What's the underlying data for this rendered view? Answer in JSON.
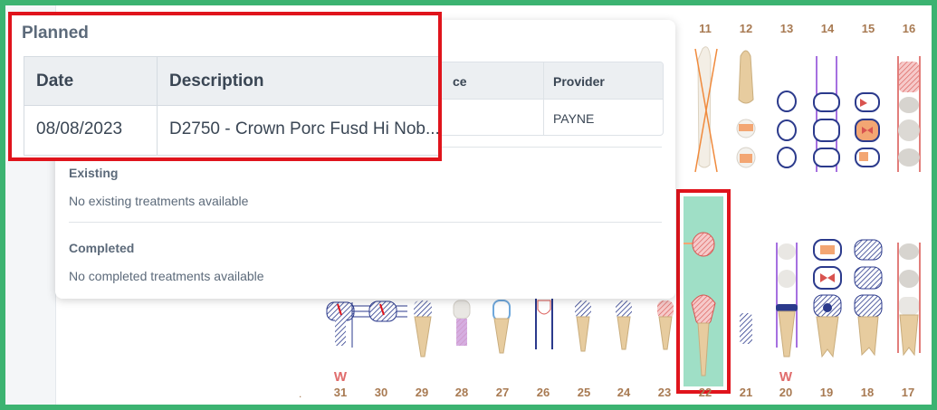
{
  "popover": {
    "planned": {
      "title": "Planned",
      "columns": [
        "Date",
        "Description"
      ],
      "rows": [
        {
          "date": "08/08/2023",
          "description": "D2750 - Crown Porc Fusd Hi Nob..."
        }
      ]
    },
    "background_table": {
      "columns": [
        "ce",
        "Provider"
      ],
      "rows": [
        {
          "provider": "PAYNE"
        }
      ]
    },
    "existing": {
      "title": "Existing",
      "empty_text": "No existing treatments available"
    },
    "completed": {
      "title": "Completed",
      "empty_text": "No completed treatments available"
    }
  },
  "chart": {
    "upper_teeth_numbers": [
      "11",
      "12",
      "13",
      "14",
      "15",
      "16"
    ],
    "lower_teeth_numbers": [
      "31",
      "30",
      "29",
      "28",
      "27",
      "26",
      "25",
      "24",
      "23",
      "22",
      "21",
      "20",
      "19",
      "18",
      "17"
    ],
    "markers": {
      "tooth_31": "W",
      "tooth_20": "W"
    },
    "dot": ".",
    "selected_tooth": "22"
  },
  "colors": {
    "frame_border": "#3cb371",
    "highlight_border": "#e0141c",
    "tooth_number": "#a87a52",
    "marker_w": "#e06c6c",
    "planned_red": "#d9534f",
    "hatch_blue": "#2b3a8c",
    "selected_fill": "#9fdfc6"
  }
}
